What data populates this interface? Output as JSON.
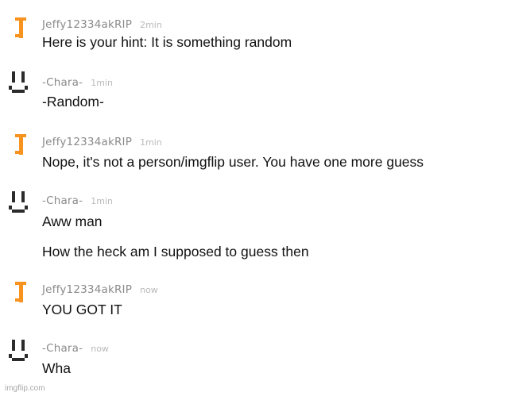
{
  "colors": {
    "accent_orange": "#f7931e",
    "avatar_dark": "#2b2b2b",
    "username_gray": "#8a8a8a",
    "time_gray": "#b9b9b9",
    "text": "#111111"
  },
  "messages": [
    {
      "username": "Jeffy12334akRIP",
      "time": "2min",
      "avatar_icon": "orange-t-icon",
      "lines": [
        "Here is your hint: It is something random"
      ]
    },
    {
      "username": "-Chara-",
      "time": "1min",
      "avatar_icon": "smiley-face-icon",
      "lines": [
        "-Random-"
      ]
    },
    {
      "username": "Jeffy12334akRIP",
      "time": "1min",
      "avatar_icon": "orange-t-icon",
      "lines": [
        "Nope, it's not a person/imgflip user. You have one more guess"
      ]
    },
    {
      "username": "-Chara-",
      "time": "1min",
      "avatar_icon": "smiley-face-icon",
      "lines": [
        "Aww man",
        "How the heck am I supposed to guess then"
      ]
    },
    {
      "username": "Jeffy12334akRIP",
      "time": "now",
      "avatar_icon": "orange-t-icon",
      "lines": [
        "YOU GOT IT"
      ]
    },
    {
      "username": "-Chara-",
      "time": "now",
      "avatar_icon": "smiley-face-icon",
      "lines": [
        "Wha"
      ]
    }
  ],
  "watermark": "imgflip.com"
}
